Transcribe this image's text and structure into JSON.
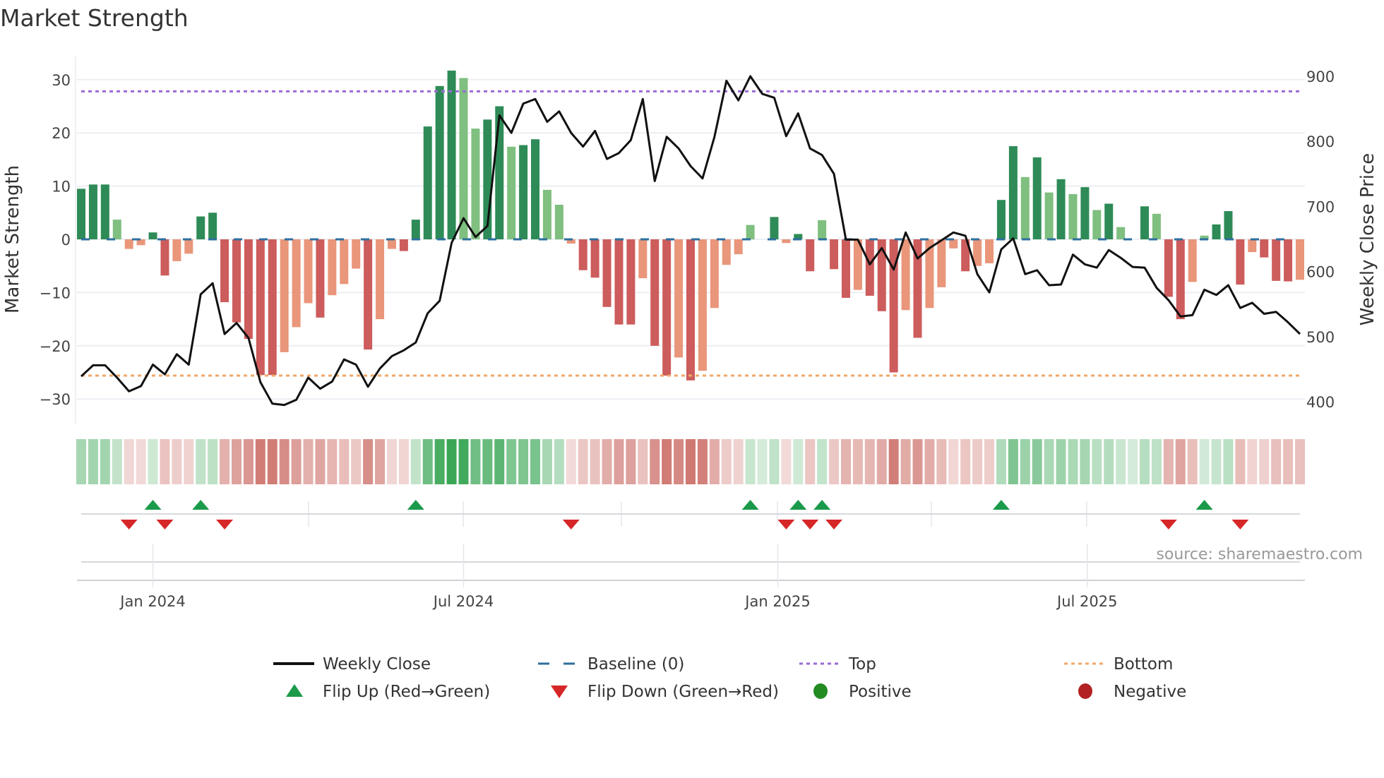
{
  "title": "Market Strength",
  "source": "source: sharemaestro.com",
  "chart_data": {
    "type": "bar",
    "title": "Market Strength",
    "ylabel": "Market Strength",
    "y2label": "Weekly Close Price",
    "ylim": [
      -35,
      34
    ],
    "y2lim": [
      352,
      925
    ],
    "yticks": [
      30,
      20,
      10,
      0,
      -10,
      -20,
      -30
    ],
    "ytick_labels": [
      "30",
      "20",
      "10",
      "0",
      "−10",
      "−20",
      "−30"
    ],
    "y2ticks": [
      900,
      800,
      700,
      600,
      500,
      400
    ],
    "y2tick_labels": [
      "900",
      "800",
      "700",
      "600",
      "500",
      "400"
    ],
    "xtick_labels": [
      {
        "label": "Jan 2024",
        "week_index": 6
      },
      {
        "label": "Jul 2024",
        "week_index": 32
      },
      {
        "label": "Jan 2025",
        "week_index": 58.3
      },
      {
        "label": "Jul 2025",
        "week_index": 84.2
      }
    ],
    "top_level": 27.8,
    "bottom_level": -25.6,
    "baseline": 0,
    "grid": true,
    "strength": [
      9.5,
      10.3,
      10.3,
      3.7,
      -1.8,
      -1.1,
      1.3,
      -6.8,
      -4.1,
      -2.7,
      4.3,
      5.0,
      -11.8,
      -15.6,
      -18.7,
      -25.5,
      -25.5,
      -21.2,
      -16.5,
      -12.0,
      -14.7,
      -10.5,
      -8.4,
      -5.5,
      -20.7,
      -15.0,
      -1.8,
      -2.2,
      3.7,
      21.2,
      28.8,
      31.7,
      30.3,
      20.8,
      22.5,
      25.0,
      17.4,
      17.7,
      18.8,
      9.3,
      6.5,
      -0.8,
      -5.8,
      -7.2,
      -12.7,
      -16.0,
      -16.0,
      -7.3,
      -20.0,
      -25.6,
      -22.2,
      -26.5,
      -24.7,
      -12.9,
      -4.8,
      -2.8,
      2.7,
      0,
      4.2,
      -0.7,
      1.0,
      -6.0,
      3.6,
      -5.6,
      -11.0,
      -9.5,
      -10.6,
      -13.5,
      -25.0,
      -13.3,
      -18.5,
      -12.9,
      -9.0,
      -1.7,
      -6.0,
      -5.0,
      -4.5,
      7.4,
      17.5,
      11.7,
      15.4,
      8.8,
      11.3,
      8.5,
      9.8,
      5.5,
      6.7,
      2.3,
      0,
      6.2,
      4.8,
      -10.8,
      -15.0,
      -8.0,
      0.7,
      2.8,
      5.3,
      -8.5,
      -2.4,
      -3.4,
      -7.8,
      -7.9,
      -7.6
    ],
    "weekly_close": [
      439,
      456,
      456,
      437,
      416,
      424,
      457,
      442,
      473,
      457,
      565,
      582,
      504,
      521,
      498,
      430,
      397,
      395,
      403,
      437,
      420,
      431,
      465,
      457,
      423,
      451,
      470,
      479,
      491,
      536,
      555,
      644,
      682,
      653,
      670,
      840,
      813,
      858,
      865,
      830,
      846,
      813,
      792,
      816,
      773,
      782,
      802,
      865,
      739,
      807,
      789,
      762,
      743,
      807,
      893,
      863,
      900,
      873,
      867,
      808,
      843,
      789,
      779,
      750,
      649,
      649,
      611,
      636,
      603,
      660,
      620,
      636,
      648,
      660,
      655,
      596,
      568,
      634,
      651,
      596,
      602,
      579,
      580,
      626,
      611,
      606,
      633,
      621,
      607,
      606,
      575,
      556,
      531,
      533,
      572,
      564,
      579,
      544,
      552,
      535,
      538,
      522,
      504
    ],
    "flip_up_weeks": [
      7,
      11,
      29,
      57,
      61,
      63,
      78,
      95
    ],
    "flip_down_weeks": [
      5,
      8,
      13,
      42,
      60,
      62,
      64,
      92,
      98
    ],
    "legend": [
      {
        "label": "Weekly Close",
        "style": "line",
        "color": "#111111"
      },
      {
        "label": "Baseline (0)",
        "style": "dash",
        "color": "#2f6f9f"
      },
      {
        "label": "Top",
        "style": "dot",
        "color": "#9b6bd6"
      },
      {
        "label": "Bottom",
        "style": "dot",
        "color": "#f0a868"
      },
      {
        "label": "Flip Up (Red→Green)",
        "style": "triangle-up",
        "color": "#1a9a4a"
      },
      {
        "label": "Flip Down (Green→Red)",
        "style": "triangle-down",
        "color": "#d62728"
      },
      {
        "label": "Positive",
        "style": "circle",
        "color": "#228b22"
      },
      {
        "label": "Negative",
        "style": "circle",
        "color": "#b22222"
      }
    ],
    "colors": {
      "pos_strong": "#2e8b57",
      "pos_weak": "#7fbf7f",
      "neg_strong": "#cd5c5c",
      "neg_weak": "#e9967a",
      "strip_pos": "#3aa655",
      "strip_neg": "#c8645c"
    }
  }
}
